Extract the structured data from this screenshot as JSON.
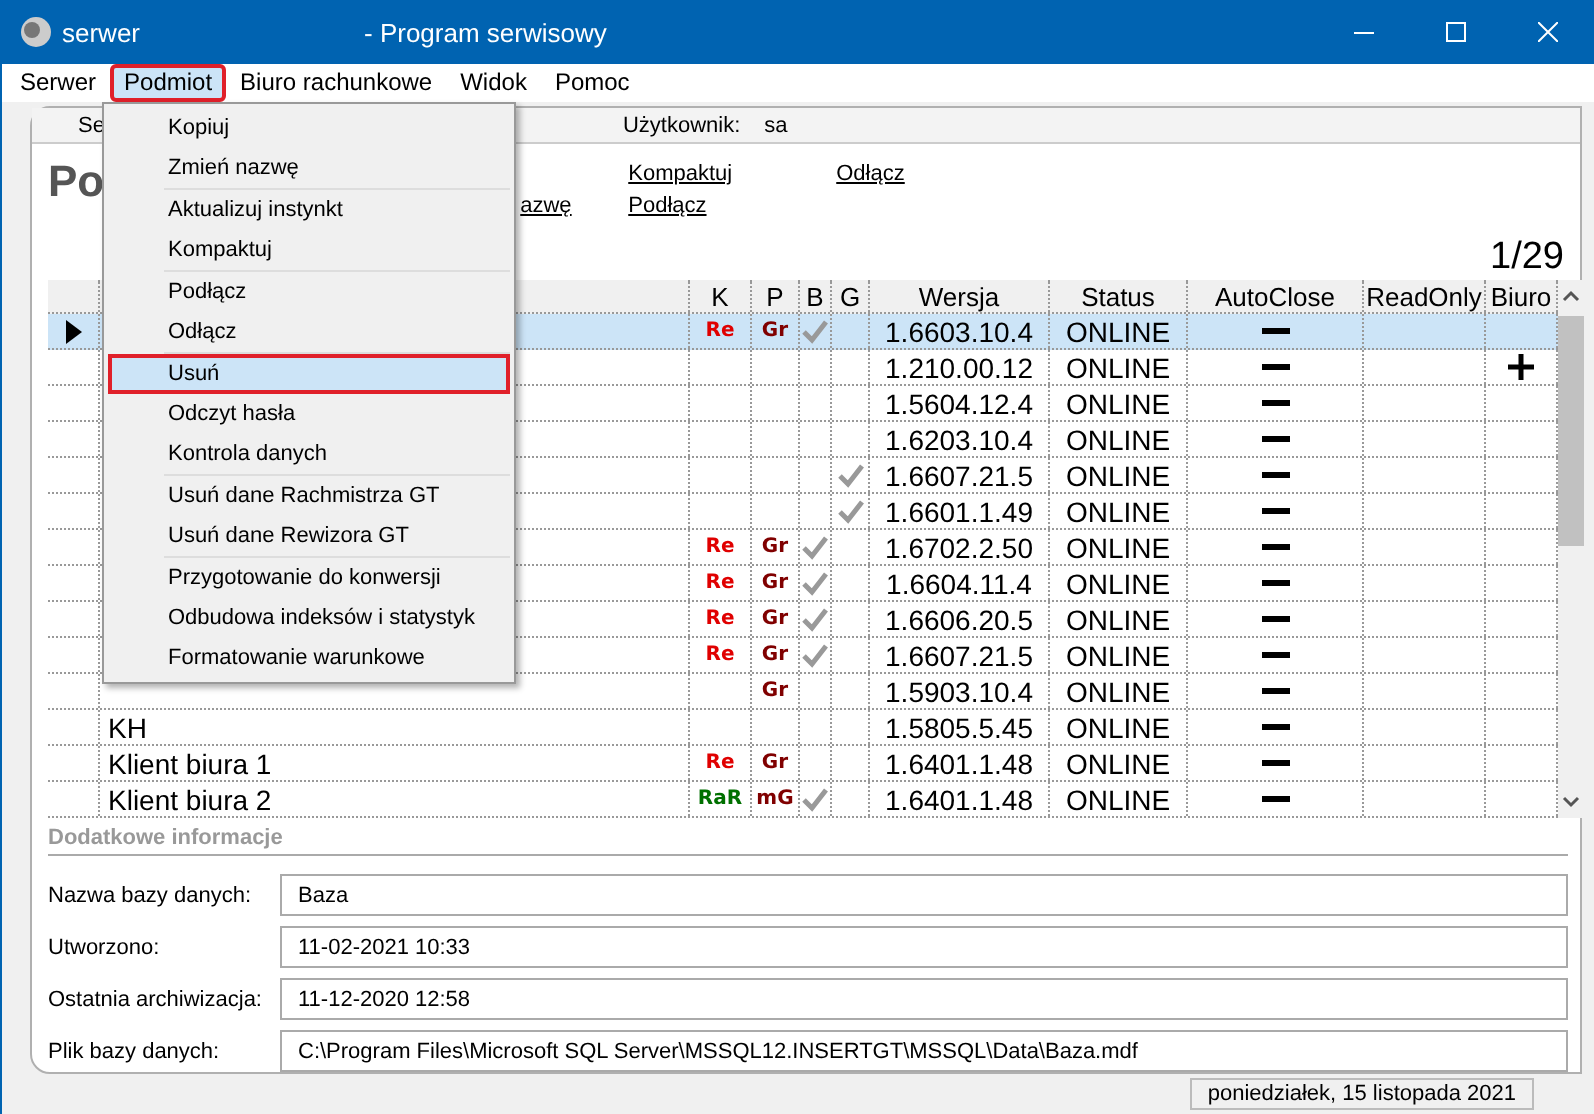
{
  "window": {
    "title_prefix": "serwer",
    "title": "- Program serwisowy"
  },
  "menu_bar": [
    {
      "label": "Serwer",
      "selected": false
    },
    {
      "label": "Podmiot",
      "selected": true
    },
    {
      "label": "Biuro rachunkowe",
      "selected": false
    },
    {
      "label": "Widok",
      "selected": false
    },
    {
      "label": "Pomoc",
      "selected": false
    }
  ],
  "dropdown": [
    [
      {
        "label": "Kopiuj",
        "selected": false
      },
      {
        "label": "Zmień nazwę",
        "selected": false
      }
    ],
    [
      {
        "label": "Aktualizuj instynkt",
        "selected": false
      },
      {
        "label": "Kompaktuj",
        "selected": false
      }
    ],
    [
      {
        "label": "Podłącz",
        "selected": false
      },
      {
        "label": "Odłącz",
        "selected": false
      }
    ],
    [
      {
        "label": "Usuń",
        "selected": true
      },
      {
        "label": "Odczyt hasła",
        "selected": false
      },
      {
        "label": "Kontrola danych",
        "selected": false
      }
    ],
    [
      {
        "label": "Usuń dane Rachmistrza GT",
        "selected": false
      },
      {
        "label": "Usuń dane Rewizora GT",
        "selected": false
      }
    ],
    [
      {
        "label": "Przygotowanie do konwersji",
        "selected": false
      },
      {
        "label": "Odbudowa indeksów i statystyk",
        "selected": false
      },
      {
        "label": "Formatowanie warunkowe",
        "selected": false
      }
    ]
  ],
  "header": {
    "left": "Se",
    "user_label": "Użytkownik:",
    "user": "sa"
  },
  "page_title": "Po",
  "links": [
    {
      "label": "Kompaktuj"
    },
    {
      "label": "Odłącz"
    },
    {
      "label": "azwę"
    },
    {
      "label": "Podłącz"
    }
  ],
  "counter": "1/29",
  "table": {
    "columns": [
      "K",
      "P",
      "B",
      "G",
      "Wersja",
      "Status",
      "AutoClose",
      "ReadOnly",
      "Biuro"
    ],
    "rows": [
      {
        "selected": true,
        "k": {
          "text": "Re",
          "color": "#e00000"
        },
        "p": {
          "text": "Gr",
          "color": "#800000"
        },
        "b": true,
        "g": false,
        "version": "1.6603.10.4",
        "status": "ONLINE",
        "auto_close": false,
        "biuro": false
      },
      {
        "selected": false,
        "b": false,
        "g": false,
        "version": "1.210.00.12",
        "status": "ONLINE",
        "auto_close": false,
        "biuro": true
      },
      {
        "selected": false,
        "b": false,
        "g": false,
        "version": "1.5604.12.4",
        "status": "ONLINE",
        "auto_close": false,
        "biuro": false
      },
      {
        "selected": false,
        "b": false,
        "g": false,
        "version": "1.6203.10.4",
        "status": "ONLINE",
        "auto_close": false,
        "biuro": false
      },
      {
        "selected": false,
        "b": false,
        "g": true,
        "version": "1.6607.21.5",
        "status": "ONLINE",
        "auto_close": false,
        "biuro": false
      },
      {
        "selected": false,
        "b": false,
        "g": true,
        "version": "1.6601.1.49",
        "status": "ONLINE",
        "auto_close": false,
        "biuro": false
      },
      {
        "selected": false,
        "k": {
          "text": "Re",
          "color": "#e00000"
        },
        "p": {
          "text": "Gr",
          "color": "#800000"
        },
        "b": true,
        "g": false,
        "version": "1.6702.2.50",
        "status": "ONLINE",
        "auto_close": false,
        "biuro": false
      },
      {
        "selected": false,
        "k": {
          "text": "Re",
          "color": "#e00000"
        },
        "p": {
          "text": "Gr",
          "color": "#800000"
        },
        "b": true,
        "g": false,
        "version": "1.6604.11.4",
        "status": "ONLINE",
        "auto_close": false,
        "biuro": false
      },
      {
        "selected": false,
        "k": {
          "text": "Re",
          "color": "#e00000"
        },
        "p": {
          "text": "Gr",
          "color": "#800000"
        },
        "b": true,
        "g": false,
        "version": "1.6606.20.5",
        "status": "ONLINE",
        "auto_close": false,
        "biuro": false
      },
      {
        "selected": false,
        "k": {
          "text": "Re",
          "color": "#e00000"
        },
        "p": {
          "text": "Gr",
          "color": "#800000"
        },
        "b": true,
        "g": false,
        "version": "1.6607.21.5",
        "status": "ONLINE",
        "auto_close": false,
        "biuro": false
      },
      {
        "selected": false,
        "p": {
          "text": "Gr",
          "color": "#800000"
        },
        "b": false,
        "g": false,
        "version": "1.5903.10.4",
        "status": "ONLINE",
        "auto_close": false,
        "biuro": false
      },
      {
        "selected": false,
        "name": "KH",
        "b": false,
        "g": false,
        "version": "1.5805.5.45",
        "status": "ONLINE",
        "auto_close": false,
        "biuro": false
      },
      {
        "selected": false,
        "name": "Klient biura 1",
        "k": {
          "text": "Re",
          "color": "#e00000"
        },
        "p": {
          "text": "Gr",
          "color": "#800000"
        },
        "b": false,
        "g": false,
        "version": "1.6401.1.48",
        "status": "ONLINE",
        "auto_close": false,
        "biuro": false
      },
      {
        "selected": false,
        "name": "Klient biura 2",
        "k": {
          "text": "RaR",
          "color": "#007000"
        },
        "p": {
          "text": "mG",
          "color": "#800000"
        },
        "b": true,
        "g": false,
        "version": "1.6401.1.48",
        "status": "ONLINE",
        "auto_close": false,
        "biuro": false
      }
    ]
  },
  "details": {
    "title": "Dodatkowe informacje",
    "fields": [
      {
        "label": "Nazwa bazy danych:",
        "value": "Baza"
      },
      {
        "label": "Utworzono:",
        "value": "11-02-2021 10:33"
      },
      {
        "label": "Ostatnia archiwizacja:",
        "value": "11-12-2020 12:58"
      },
      {
        "label": "Plik bazy danych:",
        "value": "C:\\Program Files\\Microsoft SQL Server\\MSSQL12.INSERTGT\\MSSQL\\Data\\Baza.mdf"
      }
    ]
  },
  "status_bar": {
    "date": "poniedziałek, 15 listopada 2021"
  }
}
